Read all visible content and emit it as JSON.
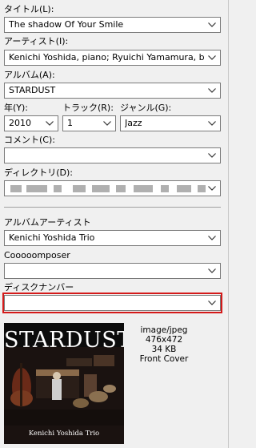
{
  "fields": {
    "title": {
      "label": "タイトル(L):",
      "value": "The shadow Of Your Smile"
    },
    "artist": {
      "label": "アーティスト(I):",
      "value": "Kenichi Yoshida, piano; Ryuichi Yamamura, bass; Yu"
    },
    "album": {
      "label": "アルバム(A):",
      "value": "STARDUST"
    },
    "year": {
      "label": "年(Y):",
      "value": "2010"
    },
    "track": {
      "label": "トラック(R):",
      "value": "1"
    },
    "genre": {
      "label": "ジャンル(G):",
      "value": "Jazz"
    },
    "comment": {
      "label": "コメント(C):",
      "value": ""
    },
    "directory": {
      "label": "ディレクトリ(D):",
      "value": ""
    },
    "album_artist": {
      "label": "アルバムアーティスト",
      "value": "Kenichi Yoshida Trio"
    },
    "composer": {
      "label": "Cooooomposer",
      "value": ""
    },
    "disc_number": {
      "label": "ディスクナンバー",
      "value": ""
    }
  },
  "cover": {
    "title": "STARDUST",
    "artist": "Kenichi Yoshida Trio",
    "mime": "image/jpeg",
    "dimensions": "476x472",
    "size": "34 KB",
    "type": "Front Cover"
  },
  "colors": {
    "highlight": "#d41a1a"
  }
}
